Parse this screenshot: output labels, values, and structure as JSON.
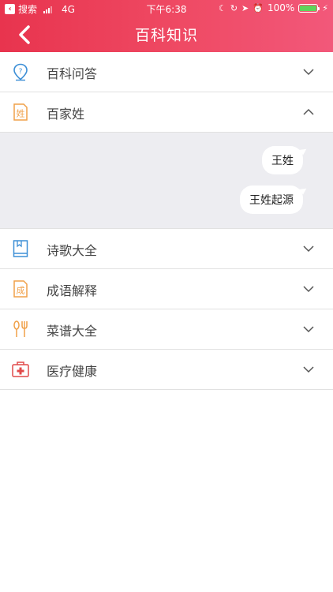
{
  "status_bar": {
    "back_app": "搜索",
    "network": "4G",
    "time": "下午6:38",
    "battery": "100%",
    "battery_color": "#5fd35a"
  },
  "nav": {
    "title": "百科知识",
    "accent": "#e8344e"
  },
  "categories": [
    {
      "label": "百科问答",
      "icon": "question-pin-icon",
      "expanded": false
    },
    {
      "label": "百家姓",
      "icon": "surname-card-icon",
      "icon_text": "姓",
      "expanded": true,
      "children": [
        "王姓",
        "王姓起源"
      ]
    },
    {
      "label": "诗歌大全",
      "icon": "book-icon",
      "expanded": false
    },
    {
      "label": "成语解释",
      "icon": "idiom-card-icon",
      "icon_text": "成",
      "expanded": false
    },
    {
      "label": "菜谱大全",
      "icon": "spoon-fork-icon",
      "expanded": false
    },
    {
      "label": "医疗健康",
      "icon": "medical-kit-icon",
      "expanded": false
    }
  ]
}
